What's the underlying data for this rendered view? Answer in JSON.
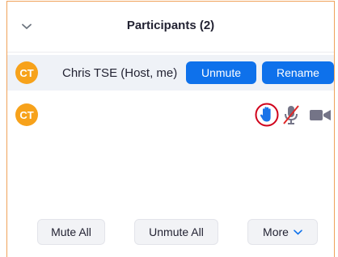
{
  "panel": {
    "title": "Participants (2)"
  },
  "participants": [
    {
      "initials": "CT",
      "name": "Chris TSE (Host, me)",
      "unmute_label": "Unmute",
      "rename_label": "Rename"
    },
    {
      "initials": "CT",
      "hand_raised": true,
      "mic_muted": true
    }
  ],
  "footer": {
    "mute_all_label": "Mute All",
    "unmute_all_label": "Unmute All",
    "more_label": "More"
  },
  "colors": {
    "accent": "#0e71eb",
    "avatar": "#f7a21b",
    "highlight_circle": "#d0021b"
  },
  "icons": {
    "collapse": "chevron-down-icon",
    "raised_hand": "raised-hand-icon",
    "mic": "mic-muted-icon",
    "camera": "video-camera-icon",
    "more": "chevron-down-icon"
  }
}
